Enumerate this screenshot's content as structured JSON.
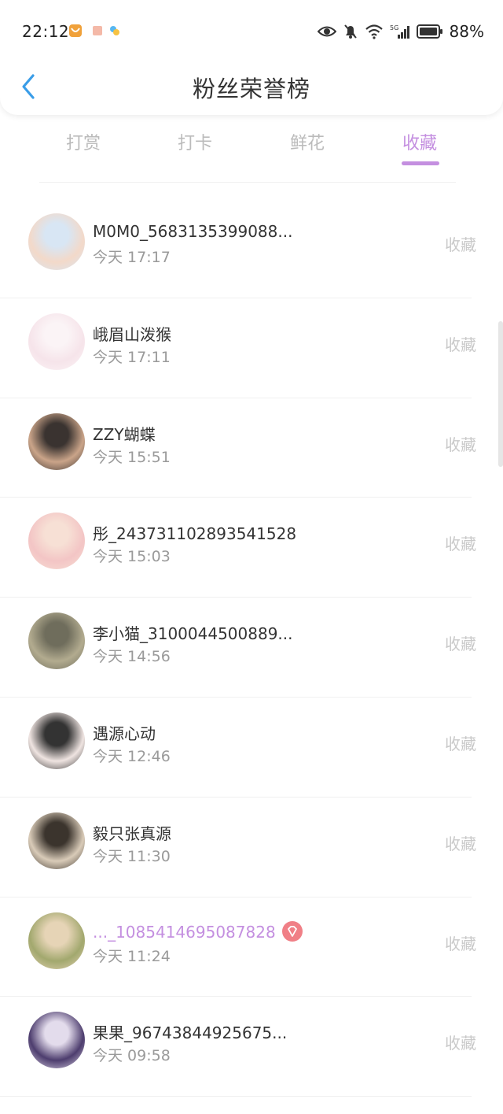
{
  "status_bar": {
    "time": "22:12",
    "battery": "88%",
    "network_label": "5G"
  },
  "header": {
    "title": "粉丝荣誉榜"
  },
  "tabs": [
    {
      "label": "打赏",
      "active": false
    },
    {
      "label": "打卡",
      "active": false
    },
    {
      "label": "鲜花",
      "active": false
    },
    {
      "label": "收藏",
      "active": true
    }
  ],
  "colors": {
    "accent": "#c48fe0",
    "back_icon": "#3a9de8",
    "muted": "#9a9a9a",
    "action": "#c9c9c9",
    "badge": "#f07f86"
  },
  "list": [
    {
      "name": "M0M0_5683135399088...",
      "time": "今天 17:17",
      "action": "收藏",
      "highlight": false,
      "badge": false,
      "avatar_colors": [
        "#f3d9c9",
        "#d8e6f4"
      ]
    },
    {
      "name": "峨眉山泼猴",
      "time": "今天 17:11",
      "action": "收藏",
      "highlight": false,
      "badge": false,
      "avatar_colors": [
        "#f6e4ea",
        "#fbf4f6"
      ]
    },
    {
      "name": "ZZY蝴蝶",
      "time": "今天 15:51",
      "action": "收藏",
      "highlight": false,
      "badge": false,
      "avatar_colors": [
        "#caa489",
        "#3a3330"
      ]
    },
    {
      "name": "彤_243731102893541528",
      "time": "今天 15:03",
      "action": "收藏",
      "highlight": false,
      "badge": false,
      "avatar_colors": [
        "#f3c5c5",
        "#f7e0d5"
      ]
    },
    {
      "name": "李小猫_3100044500889...",
      "time": "今天 14:56",
      "action": "收藏",
      "highlight": false,
      "badge": false,
      "avatar_colors": [
        "#b2ab8f",
        "#6f6d5c"
      ]
    },
    {
      "name": "遇源心动",
      "time": "今天 12:46",
      "action": "收藏",
      "highlight": false,
      "badge": false,
      "avatar_colors": [
        "#efe4e1",
        "#333333"
      ]
    },
    {
      "name": "毅只张真源",
      "time": "今天 11:30",
      "action": "收藏",
      "highlight": false,
      "badge": false,
      "avatar_colors": [
        "#d9cbb8",
        "#3b342d"
      ]
    },
    {
      "name": "..._1085414695087828",
      "time": "今天 11:24",
      "action": "收藏",
      "highlight": true,
      "badge": true,
      "avatar_colors": [
        "#a2a86e",
        "#e6d4b6"
      ]
    },
    {
      "name": "果果_96743844925675...",
      "time": "今天 09:58",
      "action": "收藏",
      "highlight": false,
      "badge": false,
      "avatar_colors": [
        "#4d3d6e",
        "#e3dcec"
      ]
    }
  ]
}
